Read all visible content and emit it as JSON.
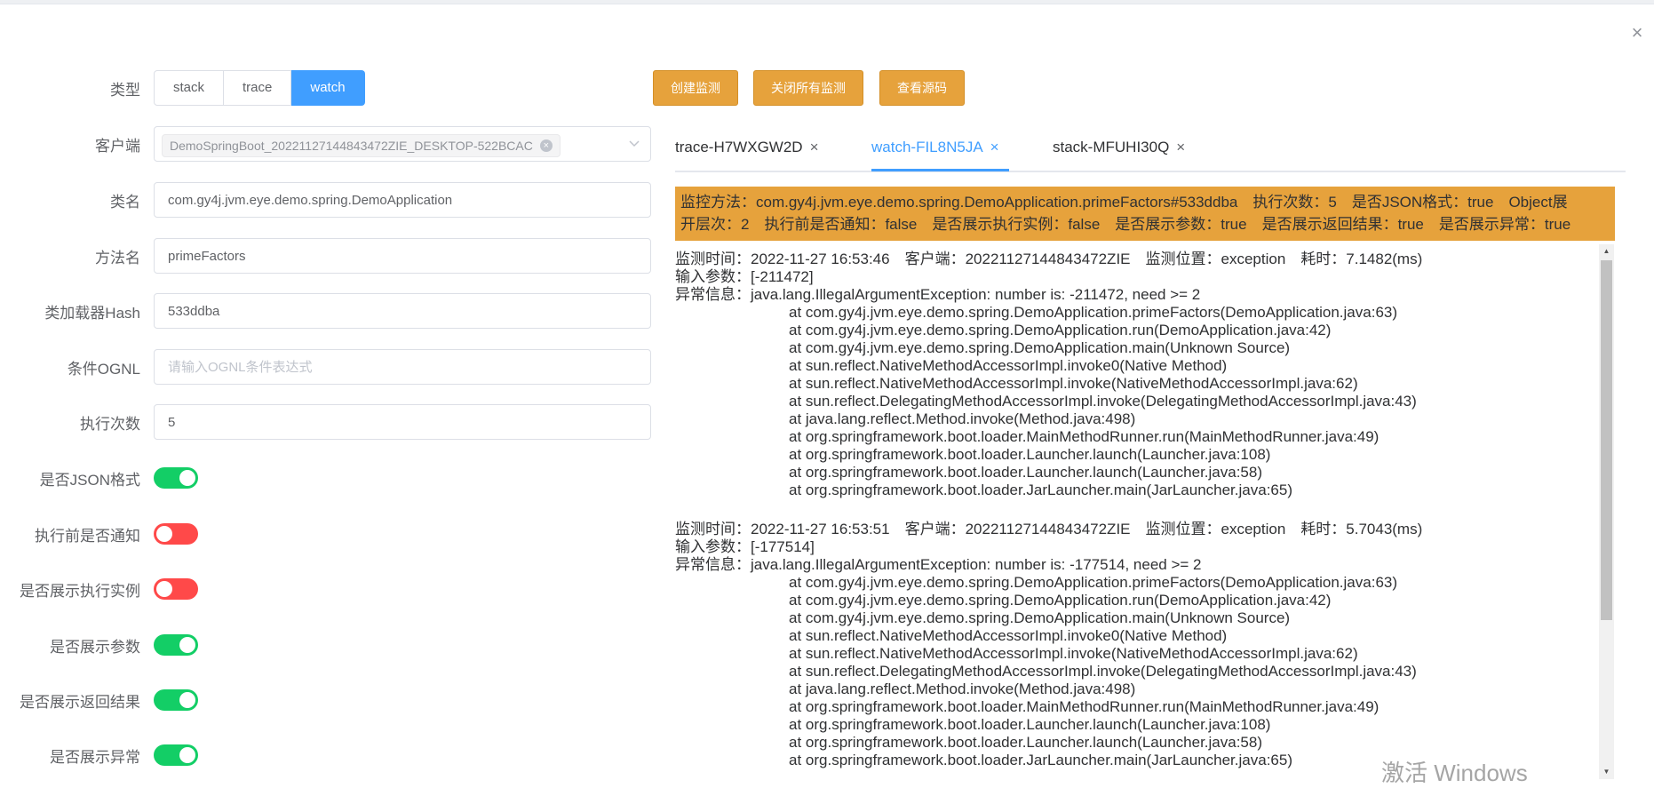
{
  "dialog": {
    "close_label": "×"
  },
  "form": {
    "type": {
      "label": "类型",
      "options": [
        "stack",
        "trace",
        "watch"
      ],
      "selected": "watch"
    },
    "client": {
      "label": "客户端",
      "tag": "DemoSpringBoot_20221127144843472ZIE_DESKTOP-522BCAC"
    },
    "class_name": {
      "label": "类名",
      "value": "com.gy4j.jvm.eye.demo.spring.DemoApplication"
    },
    "method_name": {
      "label": "方法名",
      "value": "primeFactors"
    },
    "classloader_hash": {
      "label": "类加载器Hash",
      "value": "533ddba"
    },
    "condition": {
      "label": "条件OGNL",
      "value": "",
      "placeholder": "请输入OGNL条件表达式"
    },
    "exec_count": {
      "label": "执行次数",
      "value": "5"
    },
    "switches": [
      {
        "label": "是否JSON格式",
        "on": true
      },
      {
        "label": "执行前是否通知",
        "on": false
      },
      {
        "label": "是否展示执行实例",
        "on": false
      },
      {
        "label": "是否展示参数",
        "on": true
      },
      {
        "label": "是否展示返回结果",
        "on": true
      },
      {
        "label": "是否展示异常",
        "on": true
      }
    ]
  },
  "actions": {
    "create": "创建监测",
    "close_all": "关闭所有监测",
    "view_source": "查看源码"
  },
  "tabs": [
    {
      "label": "trace-H7WXGW2D",
      "active": false
    },
    {
      "label": "watch-FIL8N5JA",
      "active": true
    },
    {
      "label": "stack-MFUHI30Q",
      "active": false
    }
  ],
  "tab_close": "×",
  "banner": {
    "line1": "监控方法：com.gy4j.jvm.eye.demo.spring.DemoApplication.primeFactors#533ddba　执行次数：5　是否JSON格式：true　Object展",
    "line2": "开层次：2　执行前是否通知：false　是否展示执行实例：false　是否展示参数：true　是否展示返回结果：true　是否展示异常：true"
  },
  "log": [
    {
      "meta": "监测时间：2022-11-27 16:53:46　客户端：20221127144843472ZIE　监测位置：exception　耗时：7.1482(ms)",
      "params": "输入参数：[-211472]",
      "error": "异常信息：java.lang.IllegalArgumentException: number is: -211472, need >= 2",
      "stack": [
        "at com.gy4j.jvm.eye.demo.spring.DemoApplication.primeFactors(DemoApplication.java:63)",
        "at com.gy4j.jvm.eye.demo.spring.DemoApplication.run(DemoApplication.java:42)",
        "at com.gy4j.jvm.eye.demo.spring.DemoApplication.main(Unknown Source)",
        "at sun.reflect.NativeMethodAccessorImpl.invoke0(Native Method)",
        "at sun.reflect.NativeMethodAccessorImpl.invoke(NativeMethodAccessorImpl.java:62)",
        "at sun.reflect.DelegatingMethodAccessorImpl.invoke(DelegatingMethodAccessorImpl.java:43)",
        "at java.lang.reflect.Method.invoke(Method.java:498)",
        "at org.springframework.boot.loader.MainMethodRunner.run(MainMethodRunner.java:49)",
        "at org.springframework.boot.loader.Launcher.launch(Launcher.java:108)",
        "at org.springframework.boot.loader.Launcher.launch(Launcher.java:58)",
        "at org.springframework.boot.loader.JarLauncher.main(JarLauncher.java:65)"
      ]
    },
    {
      "meta": "监测时间：2022-11-27 16:53:51　客户端：20221127144843472ZIE　监测位置：exception　耗时：5.7043(ms)",
      "params": "输入参数：[-177514]",
      "error": "异常信息：java.lang.IllegalArgumentException: number is: -177514, need >= 2",
      "stack": [
        "at com.gy4j.jvm.eye.demo.spring.DemoApplication.primeFactors(DemoApplication.java:63)",
        "at com.gy4j.jvm.eye.demo.spring.DemoApplication.run(DemoApplication.java:42)",
        "at com.gy4j.jvm.eye.demo.spring.DemoApplication.main(Unknown Source)",
        "at sun.reflect.NativeMethodAccessorImpl.invoke0(Native Method)",
        "at sun.reflect.NativeMethodAccessorImpl.invoke(NativeMethodAccessorImpl.java:62)",
        "at sun.reflect.DelegatingMethodAccessorImpl.invoke(DelegatingMethodAccessorImpl.java:43)",
        "at java.lang.reflect.Method.invoke(Method.java:498)",
        "at org.springframework.boot.loader.MainMethodRunner.run(MainMethodRunner.java:49)",
        "at org.springframework.boot.loader.Launcher.launch(Launcher.java:108)",
        "at org.springframework.boot.loader.Launcher.launch(Launcher.java:58)",
        "at org.springframework.boot.loader.JarLauncher.main(JarLauncher.java:65)"
      ]
    }
  ],
  "watermark": "激活 Windows",
  "colors": {
    "primary": "#409eff",
    "warning": "#e6a23c",
    "switch_on": "#13ce66",
    "switch_off": "#ff4949"
  }
}
